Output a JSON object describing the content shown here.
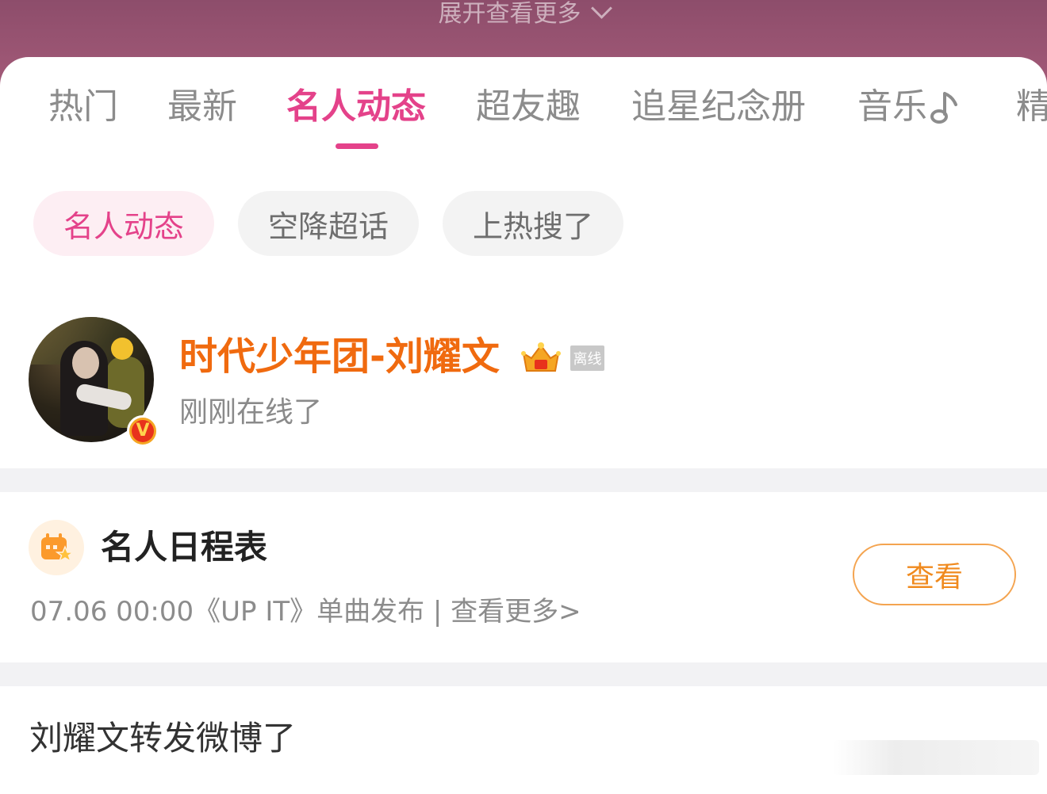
{
  "banner": {
    "expand_label": "展开查看更多"
  },
  "tabs": [
    {
      "label": "热门",
      "active": false
    },
    {
      "label": "最新",
      "active": false
    },
    {
      "label": "名人动态",
      "active": true
    },
    {
      "label": "超友趣",
      "active": false
    },
    {
      "label": "追星纪念册",
      "active": false
    },
    {
      "label": "音乐",
      "active": false
    },
    {
      "label": "精",
      "active": false
    }
  ],
  "chips": [
    {
      "label": "名人动态",
      "active": true
    },
    {
      "label": "空降超话",
      "active": false
    },
    {
      "label": "上热搜了",
      "active": false
    }
  ],
  "user": {
    "name": "时代少年团-刘耀文",
    "badge": "离线",
    "status": "刚刚在线了",
    "verified_badge": "V"
  },
  "schedule": {
    "title": "名人日程表",
    "detail": "07.06 00:00《UP IT》单曲发布 |  查看更多>",
    "button_label": "查看"
  },
  "post": {
    "text": "刘耀文转发微博了"
  },
  "colors": {
    "accent": "#e4428a",
    "name_orange": "#f06a0f",
    "button_orange": "#f08a1e",
    "banner": "#a35a78"
  }
}
